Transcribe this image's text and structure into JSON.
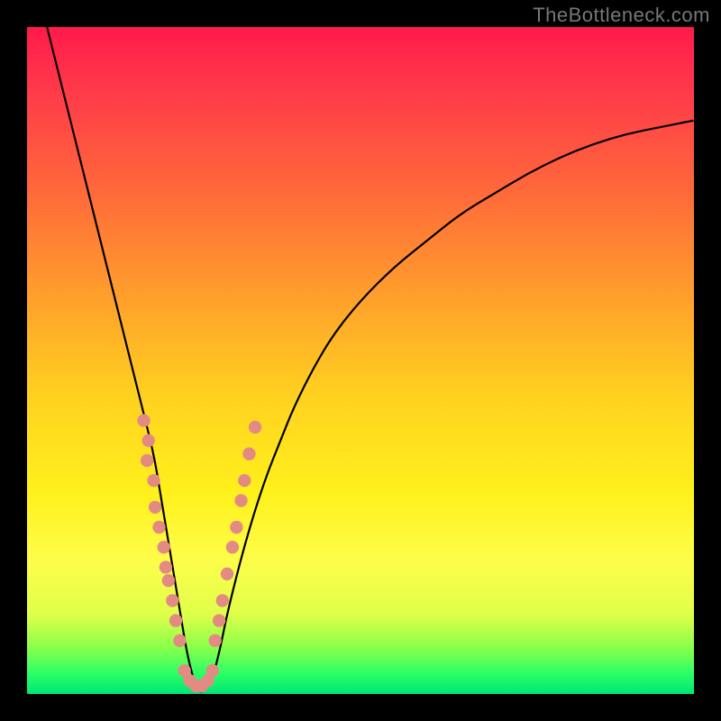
{
  "watermark": "TheBottleneck.com",
  "colors": {
    "dot": "#e38b83",
    "curve": "#000000",
    "frame_bg_top": "#ff1a4b",
    "frame_bg_bottom": "#00e676",
    "page_bg": "#000000",
    "watermark": "#777777"
  },
  "chart_data": {
    "type": "line",
    "title": "",
    "xlabel": "",
    "ylabel": "",
    "xlim": [
      0,
      100
    ],
    "ylim": [
      0,
      100
    ],
    "series": [
      {
        "name": "bottleneck-curve",
        "x": [
          3,
          5,
          7,
          9,
          11,
          13,
          15,
          17,
          19,
          20,
          21,
          22,
          23,
          24,
          25,
          26,
          27,
          28,
          29,
          30,
          32,
          34,
          36,
          38,
          40,
          43,
          46,
          50,
          55,
          60,
          65,
          70,
          75,
          80,
          85,
          90,
          95,
          100
        ],
        "y": [
          100,
          92,
          84,
          76,
          68,
          60,
          52,
          44,
          36,
          30,
          24,
          18,
          12,
          6,
          2,
          0,
          1,
          3,
          7,
          12,
          20,
          27,
          33,
          38,
          43,
          49,
          54,
          59,
          64,
          68,
          72,
          75,
          78,
          80.5,
          82.5,
          84,
          85,
          86
        ]
      }
    ],
    "dots_left": [
      {
        "x": 17.5,
        "y": 41
      },
      {
        "x": 18.2,
        "y": 38
      },
      {
        "x": 18.0,
        "y": 35
      },
      {
        "x": 19.0,
        "y": 32
      },
      {
        "x": 19.2,
        "y": 28
      },
      {
        "x": 19.8,
        "y": 25
      },
      {
        "x": 20.5,
        "y": 22
      },
      {
        "x": 20.8,
        "y": 19
      },
      {
        "x": 21.2,
        "y": 17
      },
      {
        "x": 21.8,
        "y": 14
      },
      {
        "x": 22.3,
        "y": 11
      },
      {
        "x": 22.9,
        "y": 8
      }
    ],
    "dots_right": [
      {
        "x": 28.2,
        "y": 8
      },
      {
        "x": 28.8,
        "y": 11
      },
      {
        "x": 29.3,
        "y": 14
      },
      {
        "x": 30.0,
        "y": 18
      },
      {
        "x": 30.8,
        "y": 22
      },
      {
        "x": 31.4,
        "y": 25
      },
      {
        "x": 32.1,
        "y": 29
      },
      {
        "x": 32.6,
        "y": 32
      },
      {
        "x": 33.3,
        "y": 36
      },
      {
        "x": 34.2,
        "y": 40
      }
    ],
    "dots_bottom": [
      {
        "x": 23.6,
        "y": 3.5
      },
      {
        "x": 24.4,
        "y": 2.0
      },
      {
        "x": 25.3,
        "y": 1.2
      },
      {
        "x": 26.2,
        "y": 1.2
      },
      {
        "x": 27.1,
        "y": 2.0
      },
      {
        "x": 27.8,
        "y": 3.5
      }
    ]
  }
}
